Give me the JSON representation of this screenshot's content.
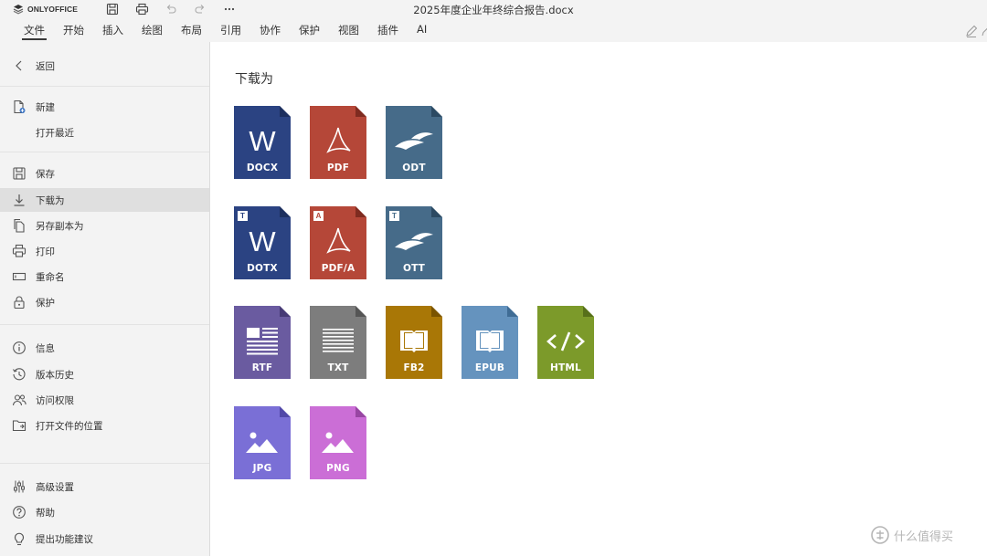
{
  "app": {
    "brand": "ONLYOFFICE",
    "document_title": "2025年度企业年终综合报告.docx"
  },
  "toolbar": {
    "tabs": [
      "文件",
      "开始",
      "插入",
      "绘图",
      "布局",
      "引用",
      "协作",
      "保护",
      "视图",
      "插件",
      "AI"
    ],
    "active_tab": "文件"
  },
  "sidebar": {
    "back": "返回",
    "new": "新建",
    "open_recent": "打开最近",
    "save": "保存",
    "download_as": "下载为",
    "save_copy_as": "另存副本为",
    "print": "打印",
    "rename": "重命名",
    "protect": "保护",
    "info": "信息",
    "version_history": "版本历史",
    "access_rights": "访问权限",
    "open_file_location": "打开文件的位置",
    "advanced_settings": "高级设置",
    "help": "帮助",
    "suggest_feature": "提出功能建议"
  },
  "main": {
    "title": "下载为",
    "formats": {
      "docx": "DOCX",
      "pdf": "PDF",
      "odt": "ODT",
      "dotx": "DOTX",
      "pdfa": "PDF/A",
      "ott": "OTT",
      "rtf": "RTF",
      "txt": "TXT",
      "fb2": "FB2",
      "epub": "EPUB",
      "html": "HTML",
      "jpg": "JPG",
      "png": "PNG"
    },
    "badges": {
      "template": "T",
      "archive": "A"
    }
  },
  "colors": {
    "docx": "#2b4382",
    "pdf": "#b54738",
    "odt": "#466b89",
    "rtf": "#6a5ba0",
    "txt": "#7d7d7d",
    "fb2": "#a97706",
    "epub": "#6593be",
    "html": "#7c9a2a",
    "jpg": "#7a6fd6",
    "png": "#cb6ed6"
  },
  "watermark": "什么值得买"
}
